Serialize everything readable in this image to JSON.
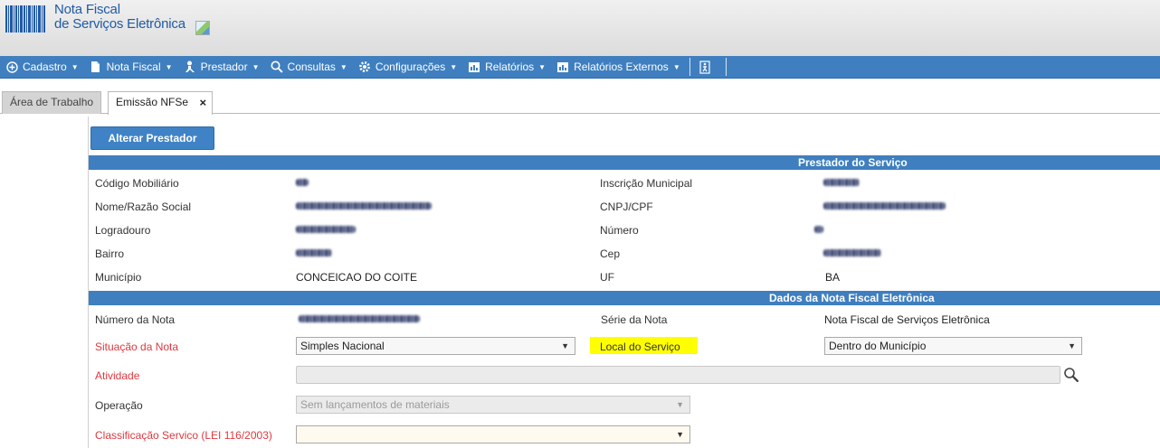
{
  "header": {
    "logo_line1": "Nota Fiscal",
    "logo_line2": "de Serviços Eletrônica",
    "brand_color": "#1f5aa6"
  },
  "menu": {
    "items": [
      {
        "label": "Cadastro",
        "icon": "plus-circle-icon"
      },
      {
        "label": "Nota Fiscal",
        "icon": "document-icon"
      },
      {
        "label": "Prestador",
        "icon": "person-icon"
      },
      {
        "label": "Consultas",
        "icon": "search-icon"
      },
      {
        "label": "Configurações",
        "icon": "gear-icon"
      },
      {
        "label": "Relatórios",
        "icon": "report-icon"
      },
      {
        "label": "Relatórios Externos",
        "icon": "report-icon"
      }
    ],
    "exit_icon": "exit-icon",
    "bar_color": "#3f7fbf"
  },
  "tabs": [
    {
      "label": "Área de Trabalho"
    },
    {
      "label": "Emissão NFSe"
    }
  ],
  "buttons": {
    "alterar_prestador": "Alterar Prestador"
  },
  "prestador": {
    "section_title": "Prestador do Serviço",
    "codigo_mobiliario_label": "Código Mobiliário",
    "inscricao_municipal_label": "Inscrição Municipal",
    "nome_label": "Nome/Razão Social",
    "cnpj_label": "CNPJ/CPF",
    "logradouro_label": "Logradouro",
    "numero_label": "Número",
    "bairro_label": "Bairro",
    "cep_label": "Cep",
    "municipio_label": "Município",
    "municipio_value": "CONCEICAO DO COITE",
    "uf_label": "UF",
    "uf_value": "BA"
  },
  "nota": {
    "section_title": "Dados da Nota Fiscal Eletrônica",
    "numero_label": "Número da Nota",
    "serie_label": "Série da Nota",
    "serie_value": "Nota Fiscal de Serviços Eletrônica",
    "situacao_label": "Situação da Nota",
    "situacao_value": "Simples Nacional",
    "local_label": "Local do Serviço",
    "local_value": "Dentro do Município",
    "atividade_label": "Atividade",
    "operacao_label": "Operação",
    "operacao_value": "Sem lançamentos de materiais",
    "classificacao_label": "Classificação Servico (LEI 116/2003)",
    "classificacao_value": ""
  },
  "colors": {
    "required_label": "#e0383d",
    "highlight": "#ffff00"
  }
}
